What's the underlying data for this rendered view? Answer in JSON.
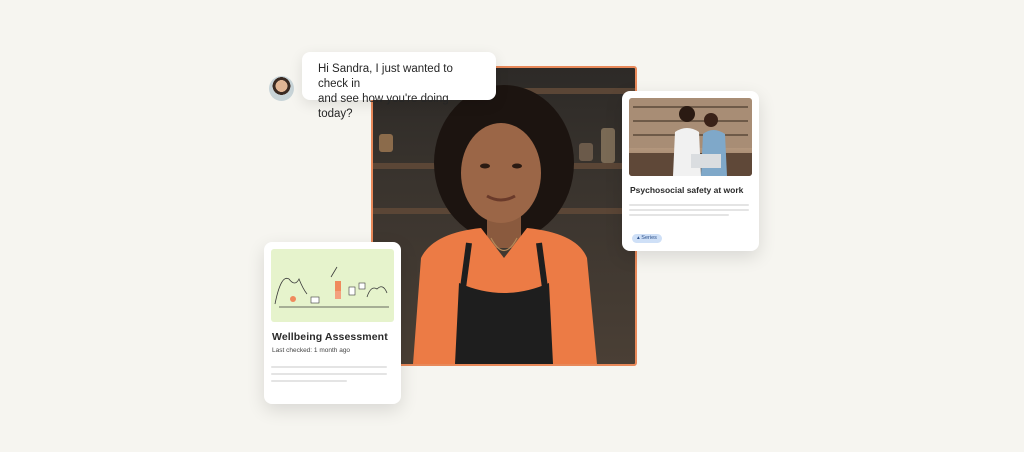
{
  "chat": {
    "message_line1": "Hi Sandra, I just wanted to check in",
    "message_line2": "and see how you're doing today?"
  },
  "series_card": {
    "title": "Psychosocial safety at work",
    "badge": "Series",
    "badge_icon": "books-icon"
  },
  "assessment_card": {
    "title": "Wellbeing Assessment",
    "last_checked": "Last checked: 1 month ago"
  },
  "colors": {
    "accent": "#e8895a",
    "background": "#f6f5f0",
    "badge_bg": "#cfe0f7",
    "illustration_bg": "#e6f3cc"
  }
}
